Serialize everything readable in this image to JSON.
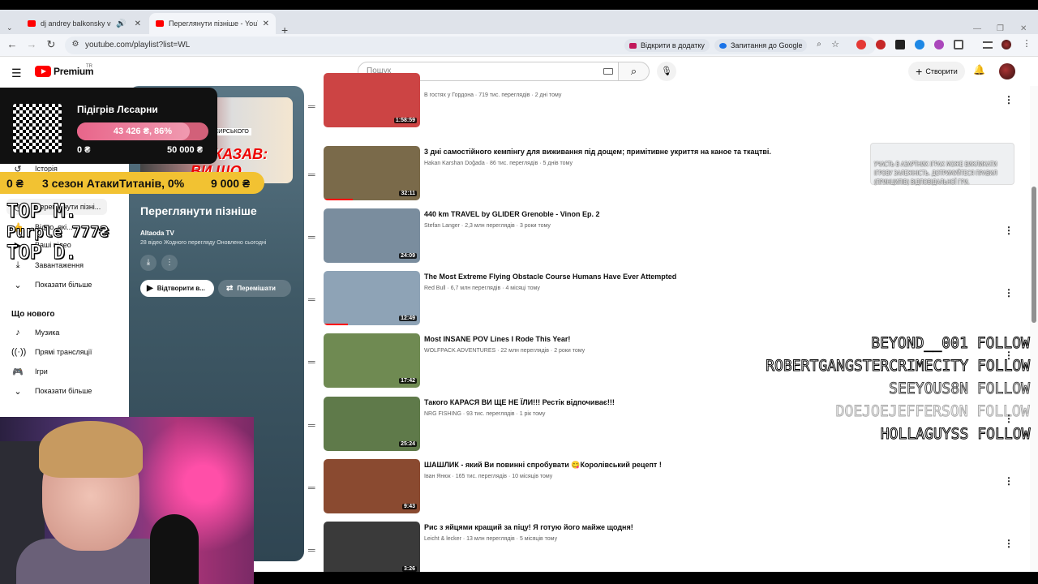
{
  "browser": {
    "tabs": [
      {
        "title": "dj andrey balkonsky vs dj d"
      },
      {
        "title": "Переглянути пізніше - YouTub"
      }
    ],
    "url": "youtube.com/playlist?list=WL",
    "open_in_app": "Відкрити в додатку",
    "ask_google": "Запитання до Google"
  },
  "yt": {
    "logo": "Premium",
    "region": "TR",
    "search_placeholder": "Пошук",
    "create": "Створити"
  },
  "sidebar": {
    "items": [
      {
        "label": "Історія"
      },
      {
        "label": "Переглянути пізні..."
      },
      {
        "label": "Відео, які..."
      },
      {
        "label": "Ваші відео"
      },
      {
        "label": "Завантаження"
      },
      {
        "label": "Показати більше"
      }
    ],
    "new_heading": "Що нового",
    "new_items": [
      {
        "label": "Музика"
      },
      {
        "label": "Прямі трансляції"
      },
      {
        "label": "Ігри"
      },
      {
        "label": "Показати більше"
      }
    ]
  },
  "playlist": {
    "thumb_caption": "«Я КАЗАВ: ВИ ЩО,",
    "thumb_caption_small": "ПРОТИ СИРСЬКОГО",
    "title": "Переглянути пізніше",
    "owner": "Altaoda TV",
    "meta": "28 відео  Жодного перегляду  Оновлено сьогодні",
    "play_all": "Відтворити в...",
    "shuffle": "Перемішати"
  },
  "videos": [
    {
      "title": "",
      "channel": "В гостях у Гордона",
      "views": "719 тис. переглядів",
      "age": "2 дні тому",
      "duration": "1:58:59",
      "progress": 0.0,
      "thumb_color": "#c44"
    },
    {
      "title": "3 дні самостійного кемпінгу для виживання під дощем; примітивне укриття на каное та ткацтві.",
      "channel": "Hakan Karshan Doğada",
      "views": "86 тис. переглядів",
      "age": "5 днів тому",
      "duration": "32:11",
      "progress": 0.3,
      "thumb_color": "#7a6a4a"
    },
    {
      "title": "440 km TRAVEL by GLIDER Grenoble - Vinon Ep. 2",
      "channel": "Stefan Langer",
      "views": "2,3 млн переглядів",
      "age": "3 роки тому",
      "duration": "24:09",
      "progress": 0.0,
      "thumb_color": "#7a8d9e"
    },
    {
      "title": "The Most Extreme Flying Obstacle Course Humans Have Ever Attempted",
      "channel": "Red Bull",
      "views": "6,7 млн переглядів",
      "age": "4 місяці тому",
      "duration": "12:49",
      "progress": 0.25,
      "thumb_color": "#8ea3b6"
    },
    {
      "title": "Most INSANE POV Lines I Rode This Year!",
      "channel": "WOLFPACK ADVENTURES",
      "views": "22 млн переглядів",
      "age": "2 роки тому",
      "duration": "17:42",
      "progress": 0.0,
      "thumb_color": "#6f8a52"
    },
    {
      "title": "Такого КАРАСЯ ВИ ЩЕ НЕ ЇЛИ!!! Рестік відпочиває!!!",
      "channel": "NRG FISHING",
      "views": "93 тис. переглядів",
      "age": "1 рік тому",
      "duration": "25:24",
      "progress": 0.0,
      "thumb_color": "#5f7a4a"
    },
    {
      "title": "ШАШЛИК - який Ви повинні спробувати 😋Королівський рецепт !",
      "channel": "Іван Янюк",
      "views": "165 тис. переглядів",
      "age": "10 місяців тому",
      "duration": "9:43",
      "progress": 0.0,
      "thumb_color": "#8a4a30"
    },
    {
      "title": "Рис з яйцями кращий за піцу! Я готую його майже щодня!",
      "channel": "Leicht & lecker",
      "views": "13 млн переглядів",
      "age": "5 місяців тому",
      "duration": "3:26",
      "progress": 0.0,
      "thumb_color": "#3a3a3a"
    }
  ],
  "overlay": {
    "donation_name": "Підігрів Лєсарни",
    "donation_bar": "43 426 ₴, 86%",
    "donation_progress": 0.86,
    "donation_min": "0 ₴",
    "donation_max": "50 000 ₴",
    "goal2_start": "0 ₴",
    "goal2_label": "3 сезон АтакиТитанів, 0%",
    "goal2_end": "9 000 ₴",
    "topm": "TOP M.",
    "purple": "Purple 777₴",
    "topd": "TOP D.",
    "promo": "УЧАСТЬ В АЗАРТНИХ ІГРАХ МОЖЕ ВИКЛИКАТИ ІГРОВУ ЗАЛЕЖНІСТЬ. ДОТРИМУЙТЕСЯ ПРАВИЛ (ПРИНЦИПІВ) ВІДПОВІДАЛЬНОЇ ГРИ.",
    "follows": [
      "BEYOND__001 FOLLOW",
      "ROBERTGANGSTERCRIMECITY FOLLOW",
      "SEEYOUS8N FOLLOW",
      "DOEJOEJEFFERSON FOLLOW",
      "HOLLAGUYSS FOLLOW"
    ]
  }
}
